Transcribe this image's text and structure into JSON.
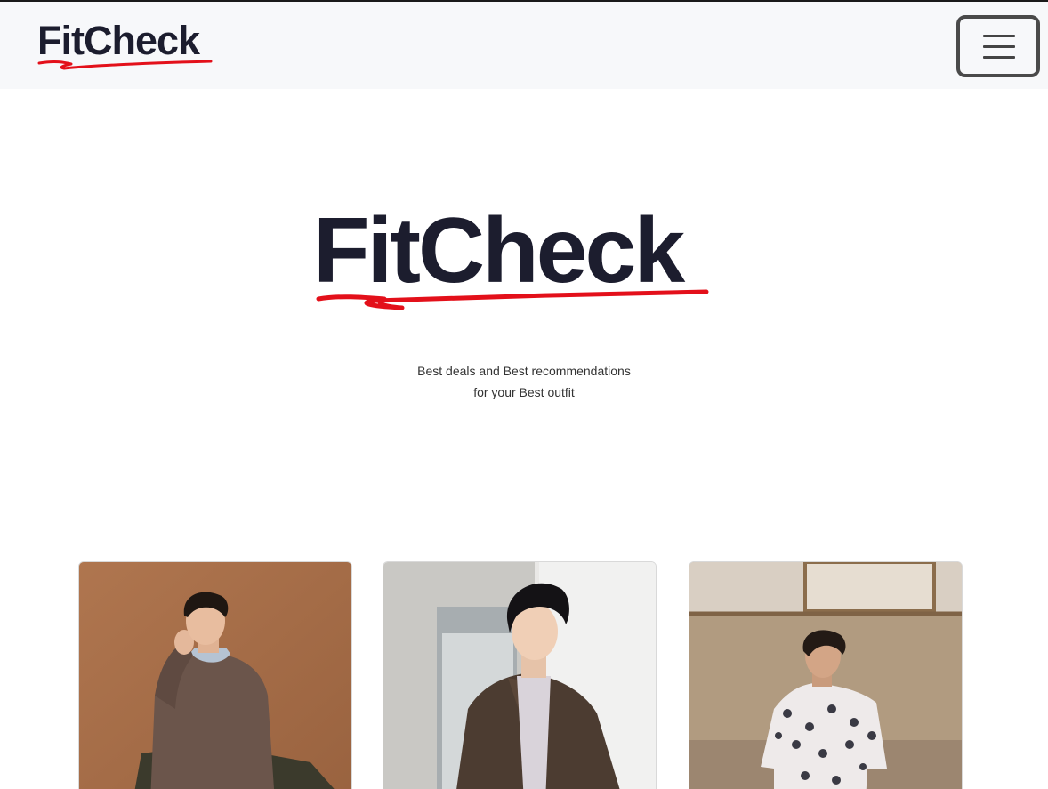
{
  "navbar": {
    "brand": "FitCheck",
    "menu_icon": "hamburger-menu-icon"
  },
  "hero": {
    "logo_text": "FitCheck",
    "tagline_line1": "Best deals and Best recommendations",
    "tagline_line2": "for your Best outfit"
  },
  "colors": {
    "brand_dark": "#1c1d2e",
    "accent_red": "#e3101a",
    "navbar_bg": "#f7f8fa"
  }
}
